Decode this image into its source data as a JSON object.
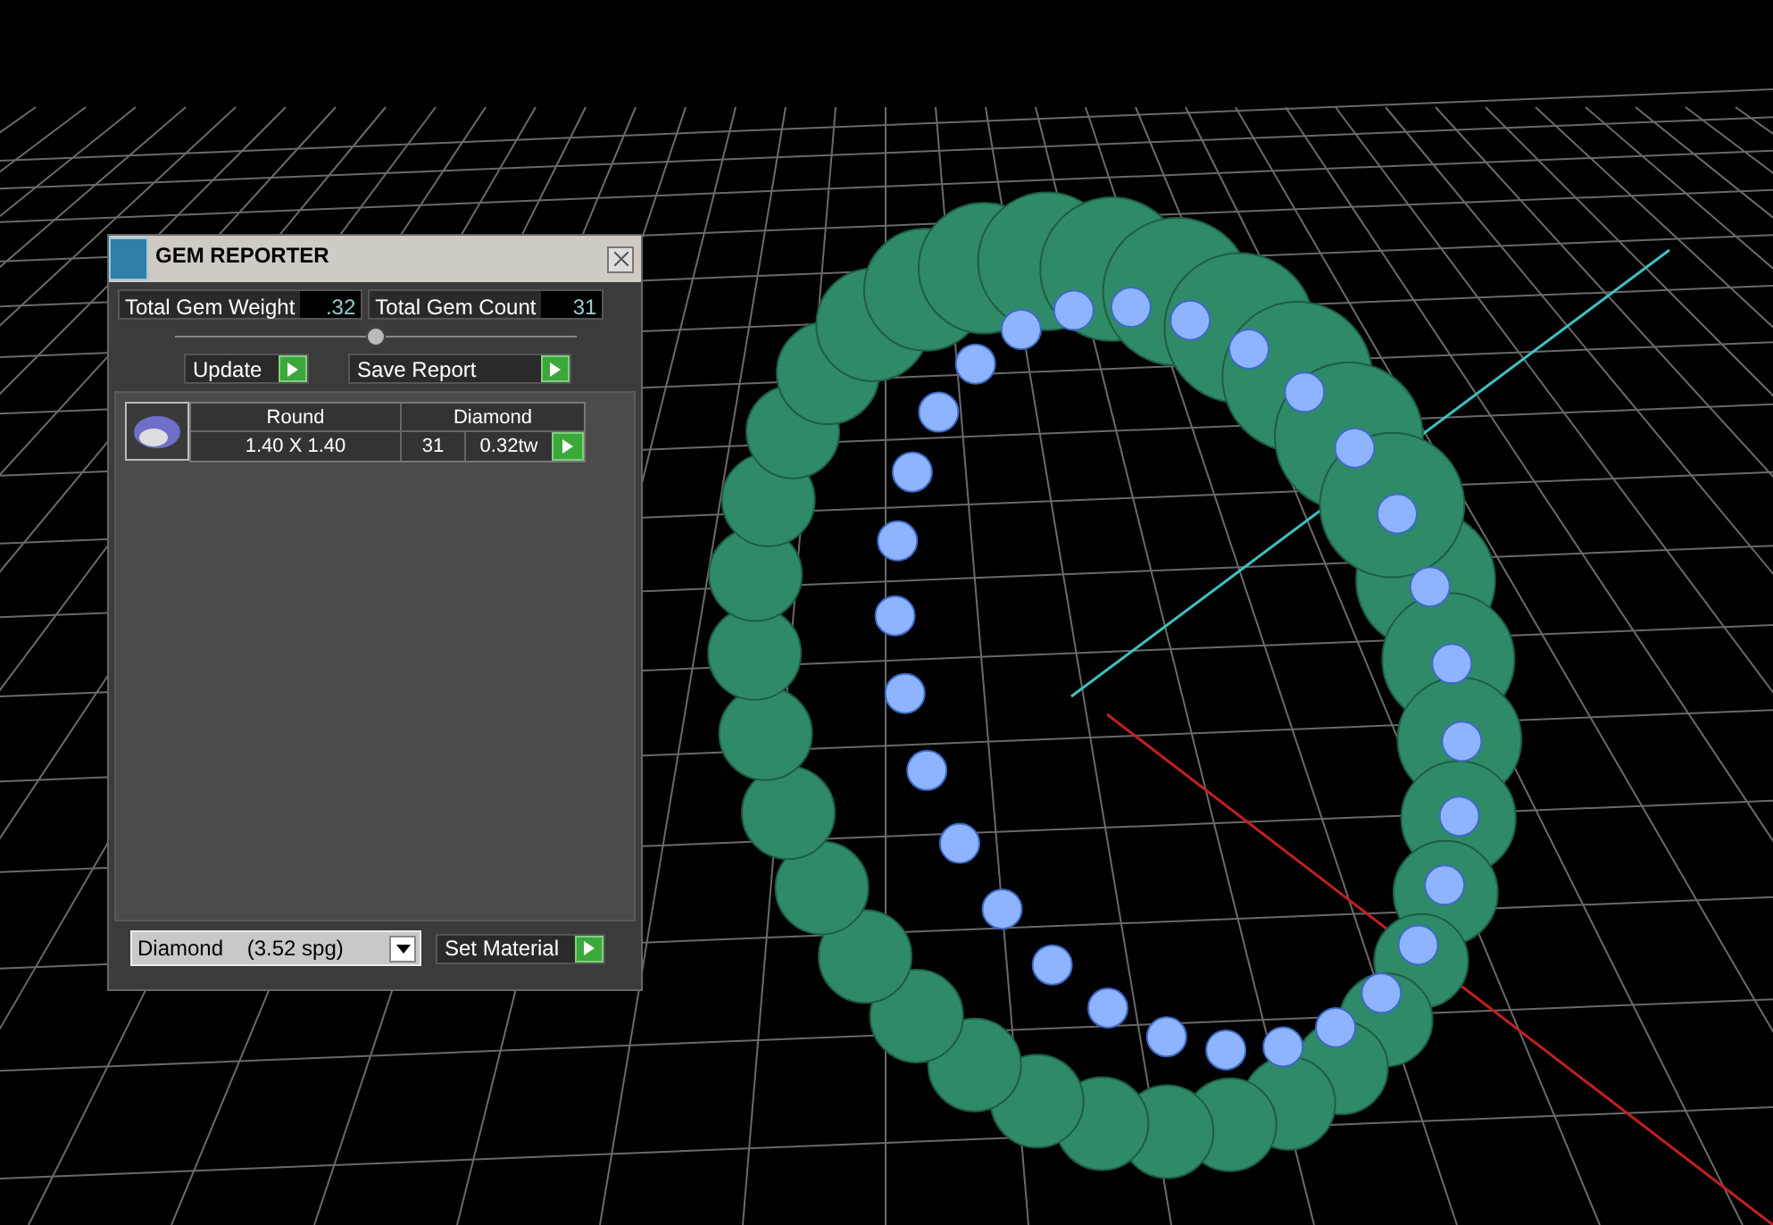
{
  "window": {
    "title": "GEM REPORTER"
  },
  "totals": [
    {
      "label": "Total Gem Weight",
      "value": ".32"
    },
    {
      "label": "Total Gem Count",
      "value": "31"
    }
  ],
  "buttons": [
    "Update",
    "Save Report"
  ],
  "gems": [
    {
      "shape": "Round",
      "size": "1.40 X 1.40",
      "material": "Diamond",
      "count": "31",
      "weight": "0.32tw"
    }
  ],
  "material_select": {
    "value": "Diamond    (3.52 spg)"
  },
  "set_button": "Set Material"
}
